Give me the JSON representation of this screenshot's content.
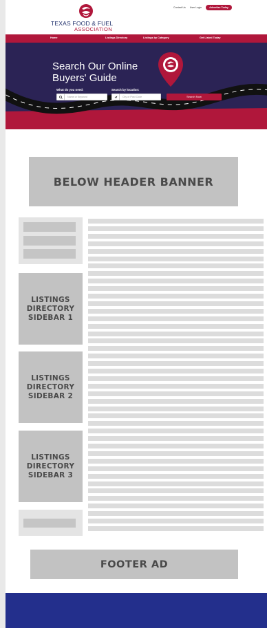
{
  "brand": {
    "name_line1": "TEXAS FOOD & FUEL",
    "name_line2": "ASSOCIATION",
    "colors": {
      "primary_red": "#b0173b",
      "navy": "#232f8c",
      "hero_bg": "#2b2355"
    },
    "logo_icon": "swirl-logo-icon"
  },
  "top_links": {
    "contact": "Contact Us",
    "login": "User Login",
    "advertise": "Advertise Today"
  },
  "nav": {
    "items": [
      "Home",
      "Listings Directory",
      "Listings by Category",
      "Get Listed Today"
    ]
  },
  "hero": {
    "title_line1": "Search Our Online",
    "title_line2": "Buyers' Guide",
    "what_label": "What do you need:",
    "where_label": "Search by location:",
    "what_placeholder": "Name or Keyword",
    "where_placeholder": "City or Post Code",
    "search_button": "Search Now",
    "pin_icon": "map-pin-icon"
  },
  "placeholders": {
    "below_header_banner": "BELOW HEADER BANNER",
    "sidebar1": [
      "LISTINGS",
      "DIRECTORY",
      "SIDEBAR 1"
    ],
    "sidebar2": [
      "LISTINGS",
      "DIRECTORY",
      "SIDEBAR 2"
    ],
    "sidebar3": [
      "LISTINGS",
      "DIRECTORY",
      "SIDEBAR 3"
    ],
    "footer_ad": "FOOTER AD"
  }
}
